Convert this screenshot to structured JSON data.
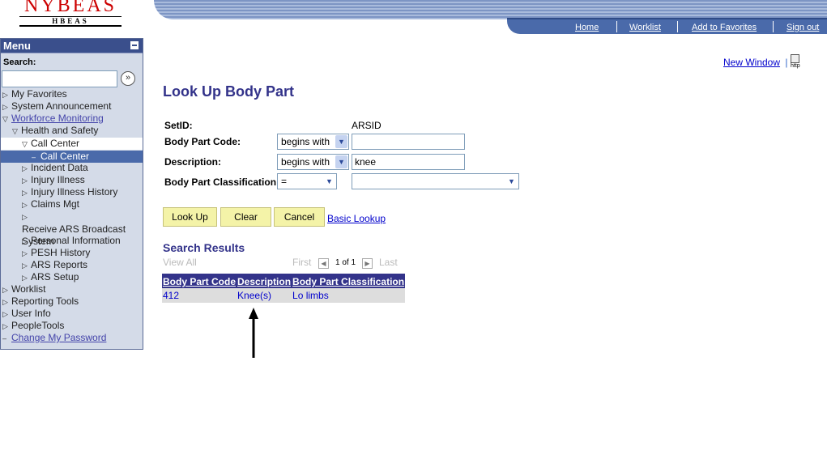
{
  "logo": {
    "title": "NYBEAS",
    "subtitle": "HBEAS"
  },
  "header_links": [
    "Home",
    "Worklist",
    "Add to Favorites",
    "Sign out"
  ],
  "menu": {
    "title": "Menu",
    "search_label": "Search:",
    "search_value": "",
    "items": [
      {
        "label": "My Favorites",
        "icon": "triangle-right",
        "level": 0
      },
      {
        "label": "System Announcement",
        "icon": "triangle-right",
        "level": 0
      },
      {
        "label": "Workforce Monitoring",
        "icon": "triangle-down",
        "level": 0,
        "link": true
      },
      {
        "label": "Health and Safety",
        "icon": "triangle-down",
        "level": 1
      },
      {
        "label": "Call Center",
        "icon": "triangle-down",
        "level": 2
      },
      {
        "label": "Call Center",
        "icon": "dash",
        "level": 3,
        "selected": true
      },
      {
        "label": "Incident Data",
        "icon": "triangle-right",
        "level": 2
      },
      {
        "label": "Injury Illness",
        "icon": "triangle-right",
        "level": 2
      },
      {
        "label": "Injury Illness History",
        "icon": "triangle-right",
        "level": 2
      },
      {
        "label": "Claims Mgt",
        "icon": "triangle-right",
        "level": 2
      },
      {
        "label": "Receive ARS Broadcast System",
        "icon": "triangle-right",
        "level": 2
      },
      {
        "label": "Personal Information",
        "icon": "triangle-right",
        "level": 2
      },
      {
        "label": "PESH History",
        "icon": "triangle-right",
        "level": 2
      },
      {
        "label": "ARS Reports",
        "icon": "triangle-right",
        "level": 2
      },
      {
        "label": "ARS Setup",
        "icon": "triangle-right",
        "level": 2
      },
      {
        "label": "Worklist",
        "icon": "triangle-right",
        "level": 0
      },
      {
        "label": "Reporting Tools",
        "icon": "triangle-right",
        "level": 0
      },
      {
        "label": "User Info",
        "icon": "triangle-right",
        "level": 0
      },
      {
        "label": "PeopleTools",
        "icon": "triangle-right",
        "level": 0
      },
      {
        "label": "Change My Password",
        "icon": "dash",
        "level": 0,
        "link": true
      }
    ]
  },
  "new_window": "New Window",
  "http_icon_label": "http",
  "page_title": "Look Up Body Part",
  "form": {
    "setid_label": "SetID:",
    "setid_value": "ARSID",
    "code_label": "Body Part Code:",
    "code_op": "begins with",
    "code_value": "",
    "desc_label": "Description:",
    "desc_op": "begins with",
    "desc_value": "knee",
    "class_label": "Body Part Classification:",
    "class_op": "=",
    "class_value": ""
  },
  "buttons": {
    "lookup": "Look Up",
    "clear": "Clear",
    "cancel": "Cancel",
    "basic": "Basic Lookup"
  },
  "results": {
    "title": "Search Results",
    "view_all": "View All",
    "first": "First",
    "page": "1 of 1",
    "last": "Last",
    "columns": [
      "Body Part Code",
      "Description",
      "Body Part Classification"
    ],
    "rows": [
      [
        "412",
        "Knee(s)",
        "Lo limbs"
      ]
    ]
  },
  "colors": {
    "accent": "#33338a",
    "button": "#f4f3a8",
    "menu_bg": "#d4dbe8",
    "selected": "#4a6aaa"
  }
}
